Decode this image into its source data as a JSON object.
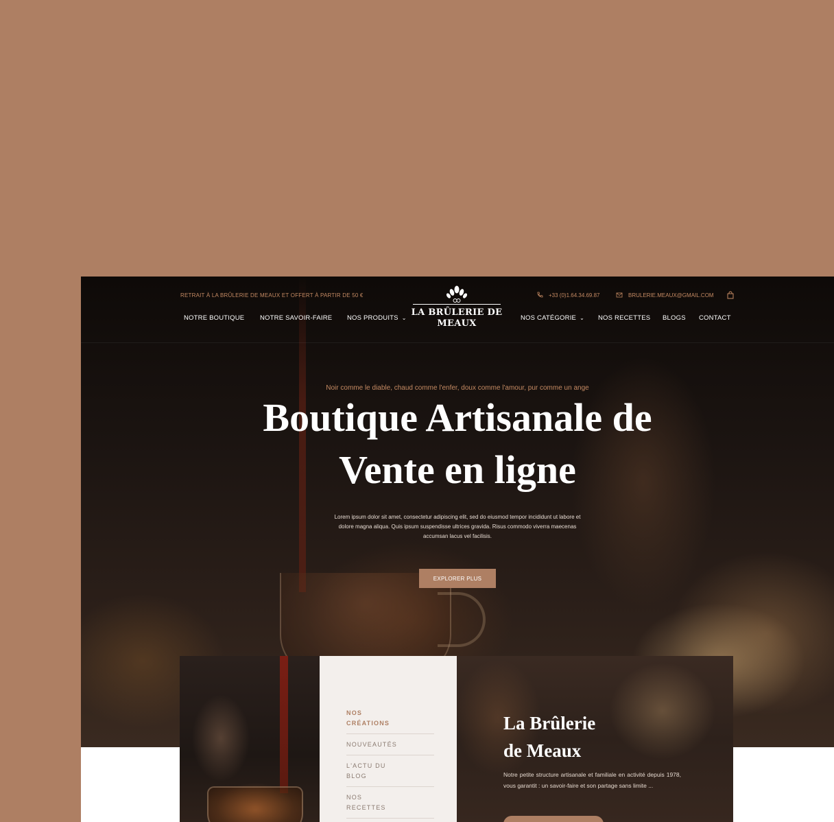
{
  "colors": {
    "accent": "#ae7f63",
    "dark": "#0e0a08",
    "panel": "#f3efec"
  },
  "topbar": {
    "promo_text": "RETRAIT À LA BRÛLERIE DE MEAUX  ET OFFERT  À PARTIR DE 50 €",
    "phone": "+33 (0)1.64.34.69.87",
    "email": "BRULERIE.MEAUX@GMAIL.COM",
    "phone_icon": "phone-icon",
    "email_icon": "envelope-icon",
    "cart_icon": "shopping-bag-icon"
  },
  "logo": {
    "name_line1": "LA BRÛLERIE DE",
    "name_line2": "MEAUX"
  },
  "nav": {
    "boutique": "NOTRE BOUTIQUE",
    "savoir_faire": "NOTRE SAVOIR-FAIRE",
    "produits": "NOS PRODUITS",
    "categorie": "NOS CATÉGORIE",
    "recettes": "NOS RECETTES",
    "blogs": "BLOGS",
    "contact": "CONTACT"
  },
  "hero": {
    "tagline": "Noir comme le diable, chaud comme l'enfer, doux comme l'amour, pur comme un ange",
    "title_line1": "Boutique Artisanale de",
    "title_line2": "Vente en ligne",
    "lead": "Lorem ipsum dolor sit amet, consectetur adipiscing elit, sed do eiusmod tempor incididunt ut labore et dolore magna aliqua. Quis ipsum suspendisse ultrices gravida. Risus commodo viverra maecenas accumsan lacus vel facilisis.",
    "button": "EXPLORER PLUS"
  },
  "menu": {
    "items": [
      {
        "line1": "NOS",
        "line2": "CRÉATIONS"
      },
      {
        "line1": "NOUVEAUTÉS",
        "line2": ""
      },
      {
        "line1": "L'ACTU DU",
        "line2": "BLOG"
      },
      {
        "line1": "NOS",
        "line2": "RECETTES"
      }
    ]
  },
  "about": {
    "title_line1": "La Brûlerie",
    "title_line2": "de Meaux",
    "text": "Notre petite structure artisanale et familiale en activité depuis 1978, vous garantit : un savoir-faire et son partage sans limite ..."
  }
}
